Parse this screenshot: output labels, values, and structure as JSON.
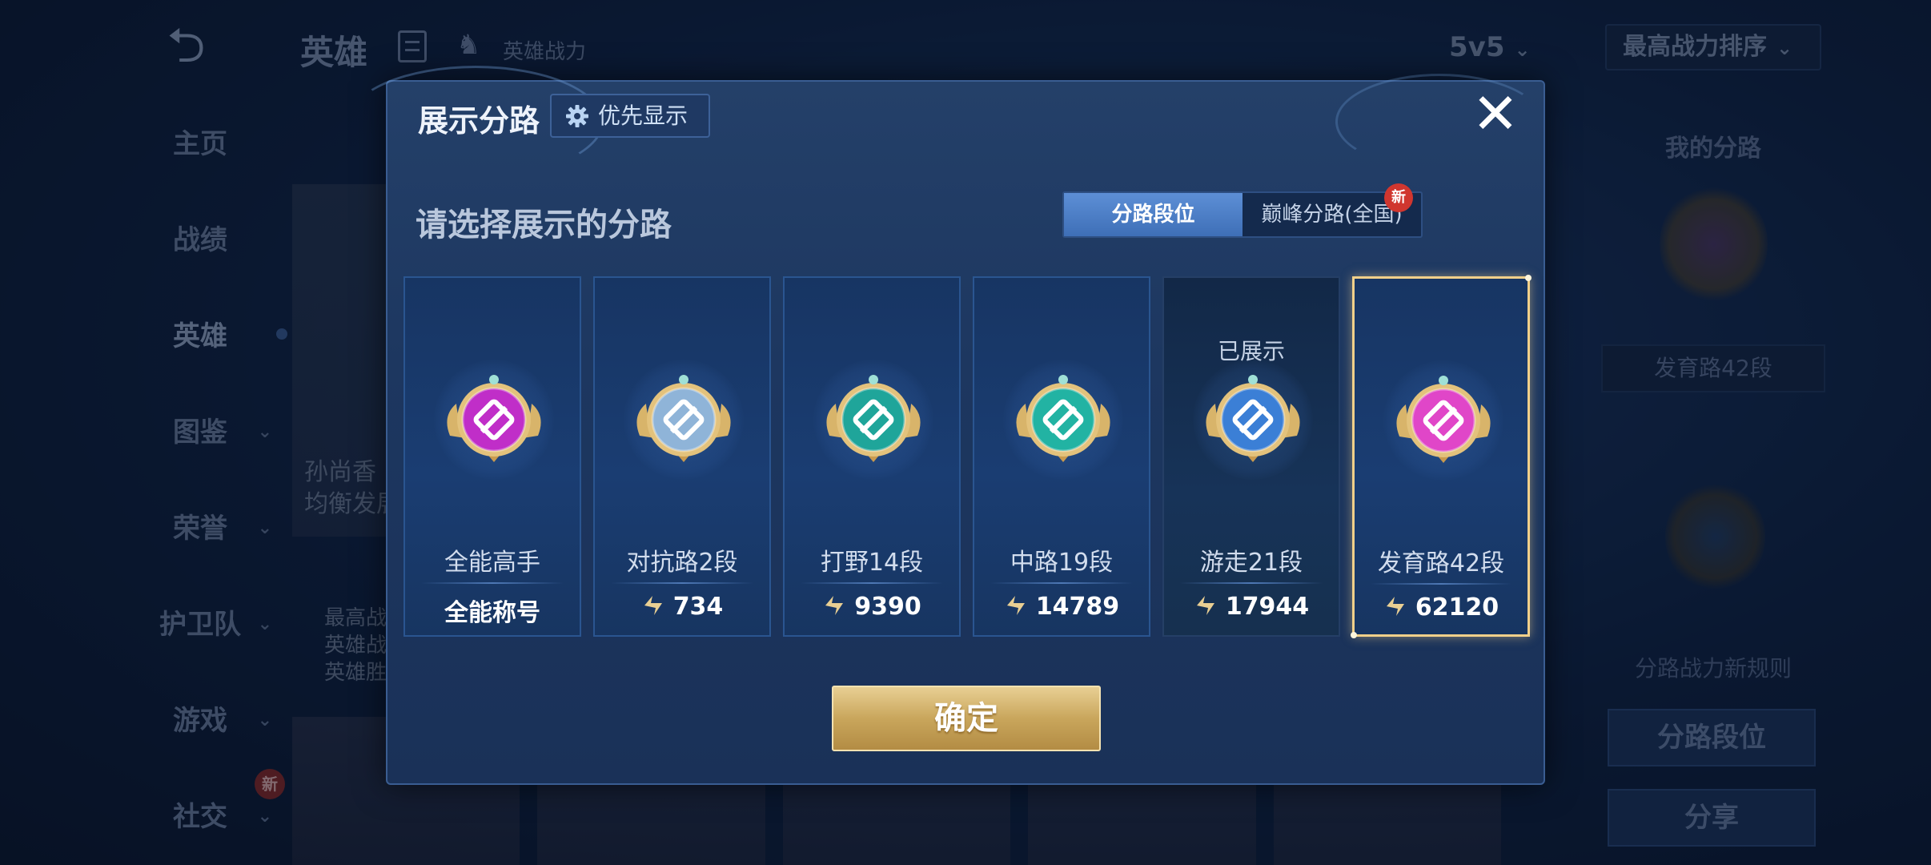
{
  "background": {
    "title": "英雄",
    "power_label": "英雄战力",
    "mode_select": "5v5",
    "sort_select": "最高战力排序",
    "nav": [
      {
        "label": "主页",
        "has_chevron": false
      },
      {
        "label": "战绩",
        "has_chevron": false
      },
      {
        "label": "英雄",
        "has_chevron": false,
        "active": true
      },
      {
        "label": "图鉴",
        "has_chevron": true
      },
      {
        "label": "荣誉",
        "has_chevron": true
      },
      {
        "label": "护卫队",
        "has_chevron": true
      },
      {
        "label": "游戏",
        "has_chevron": true
      },
      {
        "label": "社交",
        "has_chevron": true,
        "new_badge": "新"
      }
    ],
    "hero_card_lines": [
      "孙尚香",
      "均衡发展"
    ],
    "stats_lines": [
      "最高战",
      "英雄战",
      "英雄胜"
    ],
    "right_panel": {
      "title": "我的分路",
      "rank_box": "发育路42段",
      "rule_text": "分路战力新规则",
      "lane_rank_button": "分路段位",
      "share_button": "分享"
    }
  },
  "modal": {
    "title": "展示分路",
    "priority_button": "优先显示",
    "subtitle": "请选择展示的分路",
    "tabs": [
      {
        "label": "分路段位",
        "active": true
      },
      {
        "label": "巅峰分路(全国)",
        "active": false,
        "new_badge": "新"
      }
    ],
    "lanes": [
      {
        "name": "全能高手",
        "footer": "全能称号",
        "power": null,
        "badge_color": "#c02ec8",
        "shown": false,
        "selected": false
      },
      {
        "name": "对抗路2段",
        "footer": "734",
        "power": 734,
        "badge_color": "#8fb4d8",
        "shown": false,
        "selected": false
      },
      {
        "name": "打野14段",
        "footer": "9390",
        "power": 9390,
        "badge_color": "#1fa59a",
        "shown": false,
        "selected": false
      },
      {
        "name": "中路19段",
        "footer": "14789",
        "power": 14789,
        "badge_color": "#22b3a3",
        "shown": false,
        "selected": false
      },
      {
        "name": "游走21段",
        "footer": "17944",
        "power": 17944,
        "badge_color": "#3b7fd6",
        "shown": true,
        "shown_label": "已展示",
        "selected": false
      },
      {
        "name": "发育路42段",
        "footer": "62120",
        "power": 62120,
        "badge_color": "#e046c8",
        "shown": false,
        "selected": true
      }
    ],
    "confirm_button": "确定"
  }
}
